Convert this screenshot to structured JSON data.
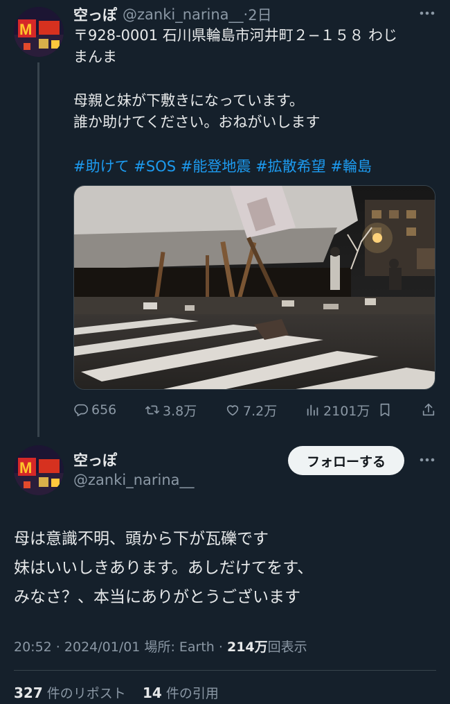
{
  "tweet1": {
    "display_name": "空っぽ",
    "handle": "@zanki_narina__",
    "separator": "·",
    "time_ago": "2日",
    "lines": [
      "〒928-0001 石川県輪島市河井町２−１５８ わじ",
      "まんま",
      "母親と妹が下敷きになっています。",
      "誰か助けてください。おねがいします"
    ],
    "hashtags": [
      "#助けて",
      "#SOS",
      "#能登地震",
      "#拡散希望",
      "#輪島"
    ],
    "actions": {
      "replies": "656",
      "retweets": "3.8万",
      "likes": "7.2万",
      "views": "2101万"
    }
  },
  "tweet2": {
    "display_name": "空っぽ",
    "handle": "@zanki_narina__",
    "follow_label": "フォローする",
    "lines": [
      "母は意識不明、頭から下が瓦礫です",
      "妹はいいしきあります。あしだけてをす、",
      "みなさ？、本当にありがとうございます"
    ],
    "meta": {
      "time": "20:52",
      "sep1": " · ",
      "date": "2024/01/01",
      "location": "場所: Earth",
      "sep2": " · ",
      "views_count": "214万",
      "views_label": "回表示"
    },
    "stats": {
      "reposts_count": "327",
      "reposts_label": "件のリポスト",
      "quotes_count": "14",
      "quotes_label": "件の引用"
    }
  },
  "icons": [
    "reply-icon",
    "retweet-icon",
    "like-icon",
    "views-icon",
    "bookmark-icon",
    "share-icon",
    "more-icon"
  ],
  "colors": {
    "background": "#15202b",
    "text": "#e7e9ea",
    "secondary": "#8b98a5",
    "link": "#1d9bf0",
    "follow_button": "#eff3f4"
  }
}
